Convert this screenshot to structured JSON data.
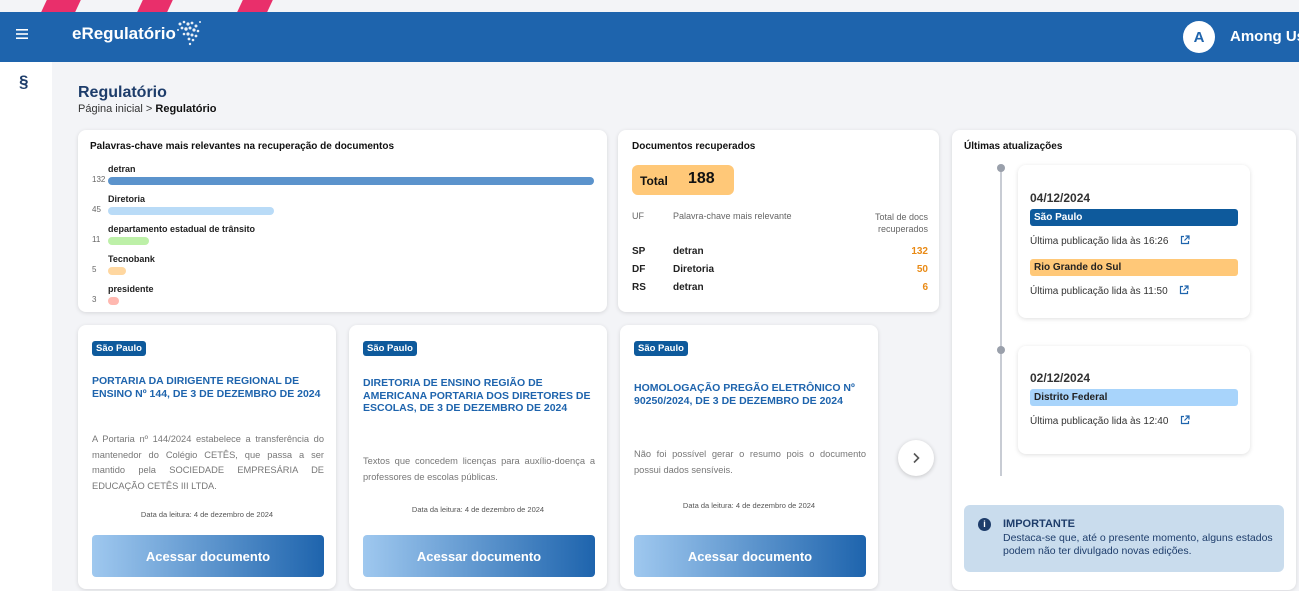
{
  "header": {
    "brand": "eRegulatório",
    "avatar_letter": "A",
    "user_name": "Among Us"
  },
  "sidebar": {
    "section_icon": "§"
  },
  "page": {
    "title": "Regulatório",
    "breadcrumb_home": "Página inicial",
    "breadcrumb_sep": ">",
    "breadcrumb_current": "Regulatório"
  },
  "keywords": {
    "title": "Palavras-chave mais relevantes na recuperação de documentos",
    "items": [
      {
        "label": "detran",
        "count": "132",
        "value": 132,
        "color": "#5b93cc"
      },
      {
        "label": "Diretoria",
        "count": "45",
        "value": 45,
        "color": "#b9dbf7"
      },
      {
        "label": "departamento estadual de trânsito",
        "count": "11",
        "value": 11,
        "color": "#bdf0a8"
      },
      {
        "label": "Tecnobank",
        "count": "5",
        "value": 5,
        "color": "#ffd7a0"
      },
      {
        "label": "presidente",
        "count": "3",
        "value": 3,
        "color": "#ffb8b0"
      }
    ]
  },
  "documents": {
    "title": "Documentos recuperados",
    "total_label": "Total",
    "total_value": "188",
    "col_uf": "UF",
    "col_keyword": "Palavra-chave mais relevante",
    "col_total": "Total de docs recuperados",
    "rows": [
      {
        "uf": "SP",
        "keyword": "detran",
        "total": "132"
      },
      {
        "uf": "DF",
        "keyword": "Diretoria",
        "total": "50"
      },
      {
        "uf": "RS",
        "keyword": "detran",
        "total": "6"
      }
    ]
  },
  "updates": {
    "title": "Últimas atualizações",
    "groups": [
      {
        "date": "04/12/2024",
        "entries": [
          {
            "state": "São Paulo",
            "text": "Última publicação lida às 16:26",
            "color": "#0e5a9c",
            "text_color": "#ffffff"
          },
          {
            "state": "Rio Grande do Sul",
            "text": "Última publicação lida às 11:50",
            "color": "#ffc878",
            "text_color": "#222222"
          }
        ]
      },
      {
        "date": "02/12/2024",
        "entries": [
          {
            "state": "Distrito Federal",
            "text": "Última publicação lida às 12:40",
            "color": "#a8d4fb",
            "text_color": "#222222"
          }
        ]
      }
    ],
    "important_title": "IMPORTANTE",
    "important_text": "Destaca-se que, até o presente momento, alguns estados podem não ter divulgado novas edições."
  },
  "news": [
    {
      "state": "São Paulo",
      "title": "PORTARIA DA DIRIGENTE REGIONAL DE ENSINO Nº 144, DE 3 DE DEZEMBRO DE 2024",
      "desc": "A Portaria nº 144/2024 estabelece a transferência do mantenedor do Colégio CETÊS, que passa a ser mantido pela SOCIEDADE EMPRESÁRIA DE EDUCAÇÃO CETÊS III LTDA.",
      "date": "Data da leitura: 4 de dezembro de 2024",
      "button": "Acessar documento"
    },
    {
      "state": "São Paulo",
      "title": "DIRETORIA DE ENSINO REGIÃO DE AMERICANA PORTARIA DOS DIRETORES DE ESCOLAS, DE 3 DE DEZEMBRO DE 2024",
      "desc": "Textos que concedem licenças para auxílio-doença a professores de escolas públicas.",
      "date": "Data da leitura: 4 de dezembro de 2024",
      "button": "Acessar documento"
    },
    {
      "state": "São Paulo",
      "title": "HOMOLOGAÇÃO PREGÃO ELETRÔNICO Nº 90250/2024, DE 3 DE DEZEMBRO DE 2024",
      "desc": "Não foi possível gerar o resumo pois o documento possui dados sensíveis.",
      "date": "Data da leitura: 4 de dezembro de 2024",
      "button": "Acessar documento"
    }
  ]
}
